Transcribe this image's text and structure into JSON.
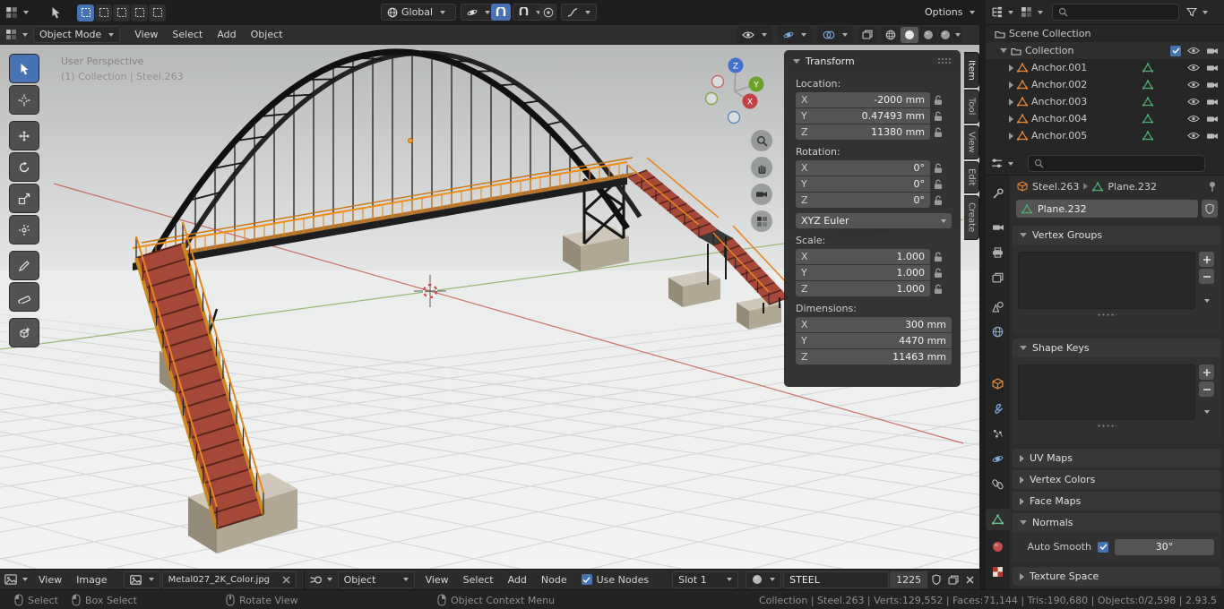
{
  "topbar": {
    "orientation": "Global",
    "options": "Options"
  },
  "viewport": {
    "mode": "Object Mode",
    "menus": {
      "view": "View",
      "select": "Select",
      "add": "Add",
      "object": "Object"
    },
    "overlay": {
      "line1": "User Perspective",
      "line2": "(1) Collection | Steel.263"
    },
    "axis": {
      "x": "X",
      "y": "Y",
      "z": "Z"
    }
  },
  "sidebar": {
    "tabs": [
      "Item",
      "Tool",
      "View",
      "Edit",
      "Create"
    ],
    "transform": {
      "title": "Transform",
      "location_label": "Location:",
      "rotation_label": "Rotation:",
      "scale_label": "Scale:",
      "dimensions_label": "Dimensions:",
      "axis_x": "X",
      "axis_y": "Y",
      "axis_z": "Z",
      "loc_x": "-2000 mm",
      "loc_y": "0.47493 mm",
      "loc_z": "11380 mm",
      "rot_x": "0°",
      "rot_y": "0°",
      "rot_z": "0°",
      "euler": "XYZ Euler",
      "scl_x": "1.000",
      "scl_y": "1.000",
      "scl_z": "1.000",
      "dim_x": "300 mm",
      "dim_y": "4470 mm",
      "dim_z": "11463 mm"
    }
  },
  "outliner": {
    "scene": "Scene Collection",
    "collection": "Collection",
    "items": [
      "Anchor.001",
      "Anchor.002",
      "Anchor.003",
      "Anchor.004",
      "Anchor.005"
    ]
  },
  "properties": {
    "breadcrumb_object": "Steel.263",
    "breadcrumb_data": "Plane.232",
    "name": "Plane.232",
    "panels": {
      "vertex_groups": "Vertex Groups",
      "shape_keys": "Shape Keys",
      "uv_maps": "UV Maps",
      "vertex_colors": "Vertex Colors",
      "face_maps": "Face Maps",
      "normals": "Normals",
      "texture_space": "Texture Space"
    },
    "auto_smooth": "Auto Smooth",
    "smooth_angle": "30°"
  },
  "image_editor": {
    "view": "View",
    "image": "Image",
    "name": "Metal027_2K_Color.jpg"
  },
  "shader_editor": {
    "type": "Object",
    "view": "View",
    "select": "Select",
    "add": "Add",
    "node": "Node",
    "use_nodes": "Use Nodes",
    "slot": "Slot 1",
    "material": "STEEL",
    "users": "1225"
  },
  "statusbar": {
    "select": "Select",
    "box_select": "Box Select",
    "rotate_view": "Rotate View",
    "context_menu": "Object Context Menu",
    "stats": "Collection | Steel.263 | Verts:129,552 | Faces:71,144 | Tris:190,680 | Objects:0/2,598 | 2.93.5"
  }
}
